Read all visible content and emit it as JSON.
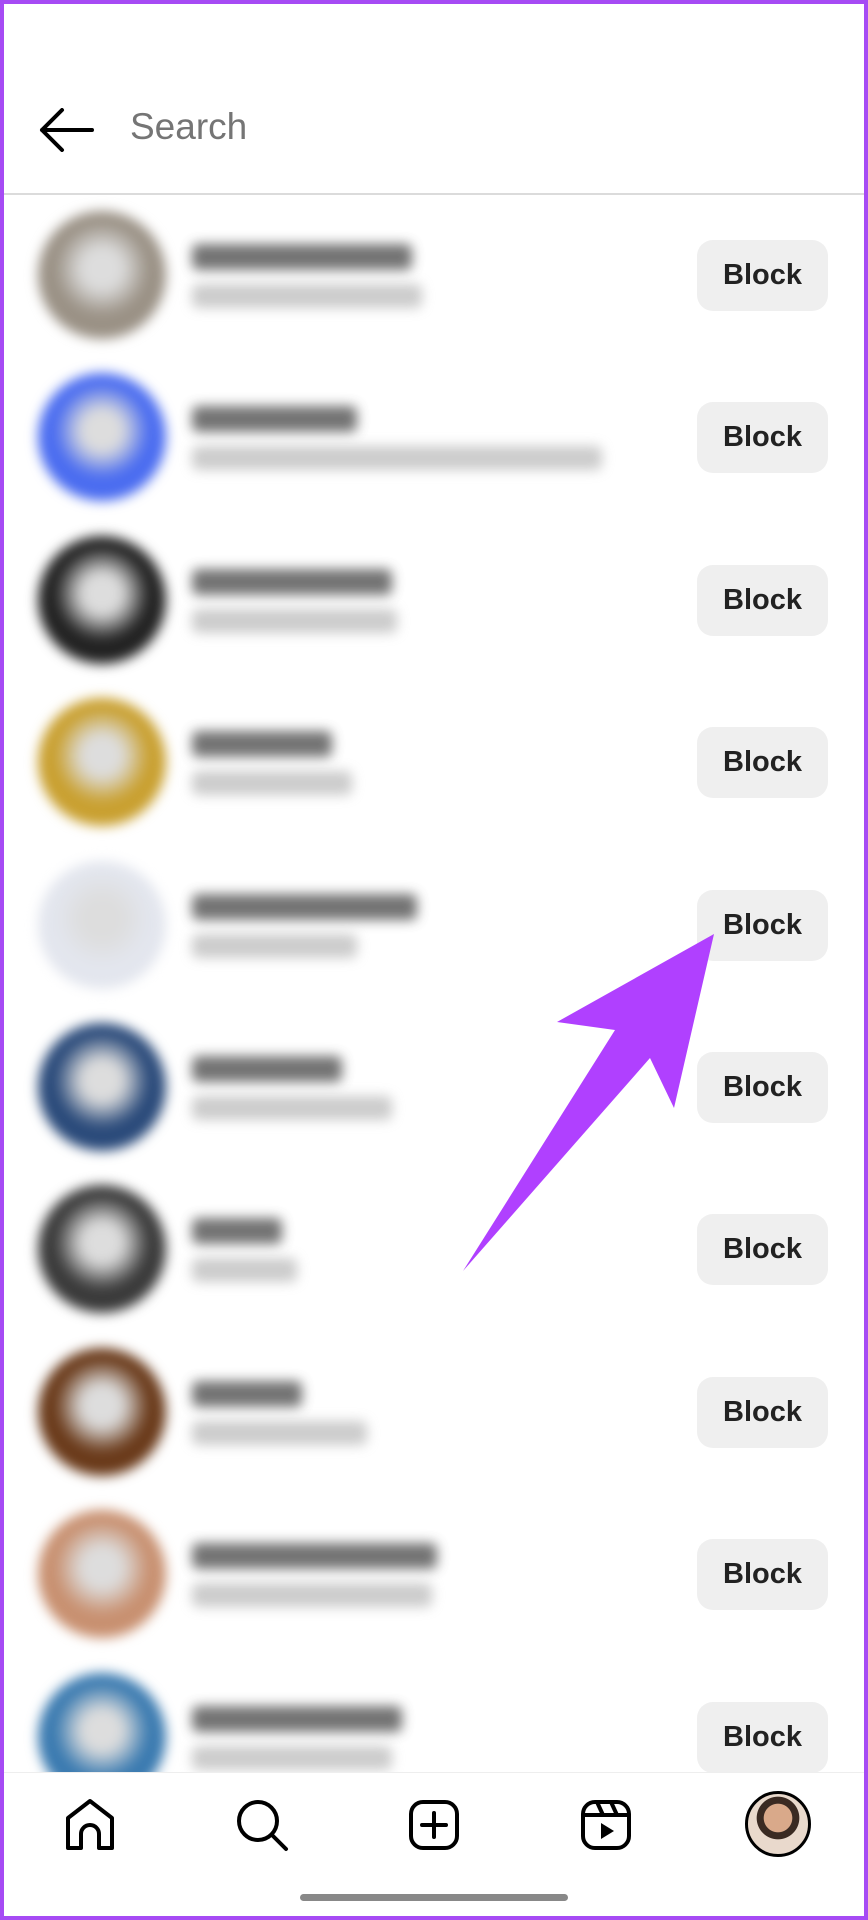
{
  "header": {
    "search_placeholder": "Search"
  },
  "list": {
    "block_label": "Block",
    "rows": [
      {
        "avatar_color": "#9a9185"
      },
      {
        "avatar_color": "#4a6cf0"
      },
      {
        "avatar_color": "#222222"
      },
      {
        "avatar_color": "#c9a030"
      },
      {
        "avatar_color": "#e3e6ee"
      },
      {
        "avatar_color": "#2a4a7a"
      },
      {
        "avatar_color": "#3a3a3a"
      },
      {
        "avatar_color": "#6a3a1a"
      },
      {
        "avatar_color": "#c89070"
      },
      {
        "avatar_color": "#3a7ab0"
      }
    ]
  },
  "nav": {
    "items": [
      "home-icon",
      "search-icon",
      "create-icon",
      "reels-icon",
      "profile-avatar"
    ]
  },
  "annotation": {
    "arrow_color": "#b040ff"
  }
}
